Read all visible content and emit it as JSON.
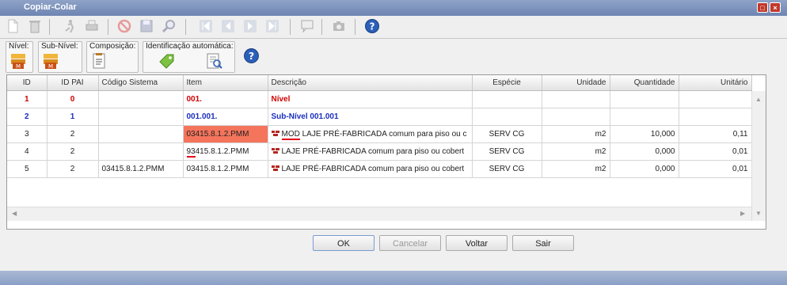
{
  "window": {
    "title": "Copiar-Colar"
  },
  "groups": {
    "nivel": "Nível:",
    "subnivel": "Sub-Nível:",
    "composicao": "Composição:",
    "identificacao": "Identificação automática:"
  },
  "table": {
    "headers": [
      "ID",
      "ID PAI",
      "Código Sistema",
      "Item",
      "Descrição",
      "Espécie",
      "Unidade",
      "Quantidade",
      "Unitário"
    ],
    "rows": [
      {
        "id": "1",
        "id_pai": "0",
        "codigo": "",
        "item": "001.",
        "descricao": "Nível",
        "especie": "",
        "unidade": "",
        "quantidade": "",
        "unitario": ""
      },
      {
        "id": "2",
        "id_pai": "1",
        "codigo": "",
        "item": "001.001.",
        "descricao": "Sub-Nível 001.001",
        "especie": "",
        "unidade": "",
        "quantidade": "",
        "unitario": ""
      },
      {
        "id": "3",
        "id_pai": "2",
        "codigo": "",
        "item": "03415.8.1.2.PMM",
        "desc_prefix": "MOD",
        "descricao": " LAJE PRÉ-FABRICADA comum para piso ou c",
        "especie": "SERV CG",
        "unidade": "m2",
        "quantidade": "10,000",
        "unitario": "0,11"
      },
      {
        "id": "4",
        "id_pai": "2",
        "codigo": "",
        "item_prefix": "93",
        "item": "415.8.1.2.PMM",
        "descricao": "LAJE PRÉ-FABRICADA comum para piso ou cobert",
        "especie": "SERV CG",
        "unidade": "m2",
        "quantidade": "0,000",
        "unitario": "0,01"
      },
      {
        "id": "5",
        "id_pai": "2",
        "codigo": "03415.8.1.2.PMM",
        "item": "03415.8.1.2.PMM",
        "descricao": "LAJE PRÉ-FABRICADA comum para piso ou cobert",
        "especie": "SERV CG",
        "unidade": "m2",
        "quantidade": "0,000",
        "unitario": "0,01"
      }
    ]
  },
  "buttons": {
    "ok": "OK",
    "cancelar": "Cancelar",
    "voltar": "Voltar",
    "sair": "Sair"
  },
  "colors": {
    "titlebar": "#7a8fbb",
    "highlight": "#f4745c",
    "level_red": "#d00000",
    "level_blue": "#1a2fbf"
  },
  "icons": [
    "new-icon",
    "delete-icon",
    "run-icon",
    "print-icon",
    "cancel-icon",
    "save-icon",
    "search-icon",
    "first-icon",
    "prev-icon",
    "next-icon",
    "last-icon",
    "comment-icon",
    "camera-icon",
    "help-icon"
  ]
}
